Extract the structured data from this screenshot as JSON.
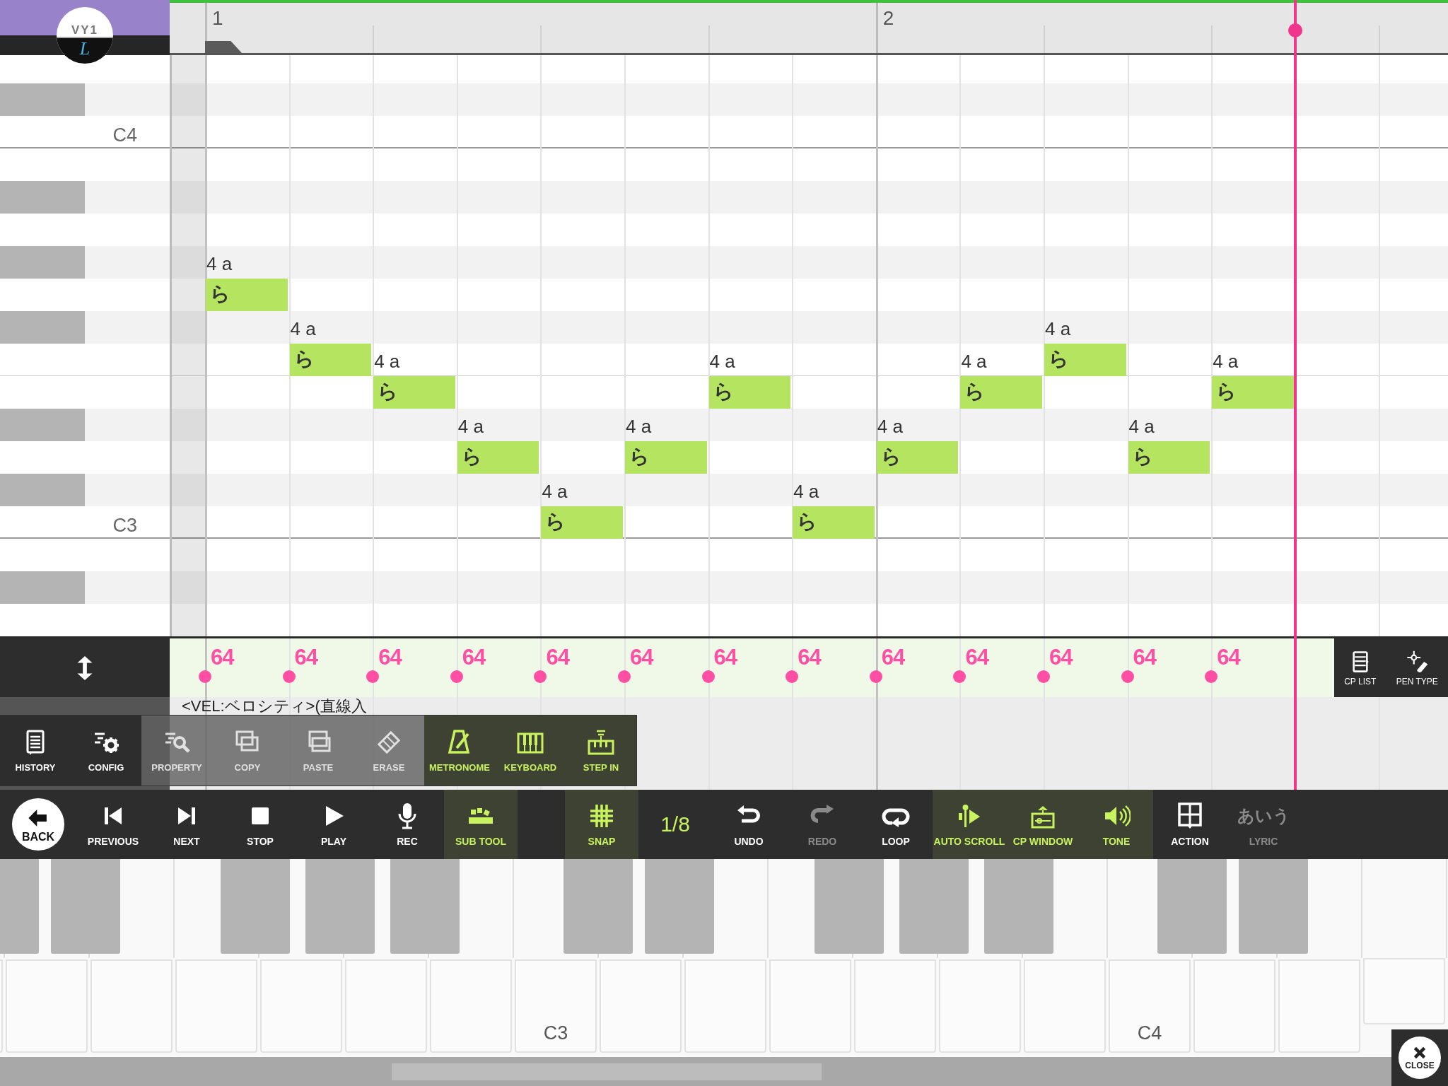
{
  "header": {
    "logo": {
      "title": "VY1",
      "mark": "L"
    },
    "bars": [
      "1",
      "2"
    ]
  },
  "rows": [
    {
      "kind": "white"
    },
    {
      "kind": "black"
    },
    {
      "kind": "white",
      "label": "C4"
    },
    {
      "kind": "white"
    },
    {
      "kind": "black"
    },
    {
      "kind": "white"
    },
    {
      "kind": "black"
    },
    {
      "kind": "white",
      "cells": [
        {
          "kind": "note",
          "label": "4 a",
          "lyric": "ら"
        }
      ]
    },
    {
      "kind": "black"
    },
    {
      "kind": "white",
      "cells": [
        {
          "kind": "rest"
        },
        {
          "kind": "note",
          "label": "4 a",
          "lyric": "ら"
        },
        {
          "kind": "rest"
        },
        {
          "kind": "rest"
        },
        {
          "kind": "rest"
        },
        {
          "kind": "rest"
        },
        {
          "kind": "rest"
        },
        {
          "kind": "rest"
        },
        {
          "kind": "rest"
        },
        {
          "kind": "rest"
        },
        {
          "kind": "note",
          "label": "4 a",
          "lyric": "ら"
        }
      ]
    },
    {
      "kind": "white",
      "cells": [
        {
          "kind": "rest"
        },
        {
          "kind": "rest"
        },
        {
          "kind": "note",
          "label": "4 a",
          "lyric": "ら"
        },
        {
          "kind": "rest"
        },
        {
          "kind": "rest"
        },
        {
          "kind": "rest"
        },
        {
          "kind": "note",
          "label": "4 a",
          "lyric": "ら"
        },
        {
          "kind": "rest"
        },
        {
          "kind": "rest"
        },
        {
          "kind": "note",
          "label": "4 a",
          "lyric": "ら"
        },
        {
          "kind": "rest"
        },
        {
          "kind": "rest"
        },
        {
          "kind": "note",
          "label": "4 a",
          "lyric": "ら"
        }
      ]
    },
    {
      "kind": "black"
    },
    {
      "kind": "white",
      "cells": [
        {
          "kind": "rest"
        },
        {
          "kind": "rest"
        },
        {
          "kind": "rest"
        },
        {
          "kind": "note",
          "label": "4 a",
          "lyric": "ら"
        },
        {
          "kind": "rest"
        },
        {
          "kind": "note",
          "label": "4 a",
          "lyric": "ら"
        },
        {
          "kind": "rest"
        },
        {
          "kind": "rest"
        },
        {
          "kind": "note",
          "label": "4 a",
          "lyric": "ら"
        },
        {
          "kind": "rest"
        },
        {
          "kind": "rest"
        },
        {
          "kind": "note",
          "label": "4 a",
          "lyric": "ら"
        }
      ]
    },
    {
      "kind": "black"
    },
    {
      "kind": "white",
      "label": "C3",
      "cells": [
        {
          "kind": "rest"
        },
        {
          "kind": "rest"
        },
        {
          "kind": "rest"
        },
        {
          "kind": "rest"
        },
        {
          "kind": "note",
          "label": "4 a",
          "lyric": "ら"
        },
        {
          "kind": "rest"
        },
        {
          "kind": "rest"
        },
        {
          "kind": "note",
          "label": "4 a",
          "lyric": "ら"
        }
      ]
    },
    {
      "kind": "white"
    },
    {
      "kind": "black"
    },
    {
      "kind": "white"
    }
  ],
  "velocities": [
    "64",
    "64",
    "64",
    "64",
    "64",
    "64",
    "64",
    "64",
    "64",
    "64",
    "64",
    "64",
    "64"
  ],
  "control_lane": {
    "title": "<VEL:ベロシティ>(直線入"
  },
  "lane_tools": [
    {
      "label": "CP LIST"
    },
    {
      "label": "PEN TYPE"
    }
  ],
  "sub_tools": [
    {
      "label": "HISTORY",
      "on": false,
      "disabled": false
    },
    {
      "label": "CONFIG",
      "on": false,
      "disabled": false
    },
    {
      "label": "PROPERTY",
      "on": false,
      "disabled": true
    },
    {
      "label": "COPY",
      "on": false,
      "disabled": true
    },
    {
      "label": "PASTE",
      "on": false,
      "disabled": true
    },
    {
      "label": "ERASE",
      "on": false,
      "disabled": true
    },
    {
      "label": "METRONOME",
      "on": true,
      "disabled": false
    },
    {
      "label": "KEYBOARD",
      "on": true,
      "disabled": false
    },
    {
      "label": "STEP IN",
      "on": true,
      "disabled": false
    }
  ],
  "toolbar": {
    "back": "BACK",
    "left": [
      {
        "kind": "button",
        "label": "PREVIOUS",
        "on": false,
        "disabled": false
      },
      {
        "kind": "button",
        "label": "NEXT",
        "on": false,
        "disabled": false
      },
      {
        "kind": "button",
        "label": "STOP",
        "on": false,
        "disabled": false
      },
      {
        "kind": "button",
        "label": "PLAY",
        "on": false,
        "disabled": false
      },
      {
        "kind": "button",
        "label": "REC",
        "on": false,
        "disabled": false
      },
      {
        "kind": "button",
        "label": "SUB TOOL",
        "on": true,
        "disabled": false
      }
    ],
    "right": [
      {
        "kind": "button",
        "label": "SNAP",
        "on": true,
        "disabled": false
      },
      {
        "kind": "value",
        "label": "1/8"
      },
      {
        "kind": "button",
        "label": "UNDO",
        "on": false,
        "disabled": false
      },
      {
        "kind": "button",
        "label": "REDO",
        "on": false,
        "disabled": true
      },
      {
        "kind": "button",
        "label": "LOOP",
        "on": false,
        "disabled": false
      },
      {
        "kind": "button",
        "label": "AUTO SCROLL",
        "on": true,
        "disabled": false
      },
      {
        "kind": "button",
        "label": "CP WINDOW",
        "on": true,
        "disabled": false
      },
      {
        "kind": "button",
        "label": "TONE",
        "on": true,
        "disabled": false
      },
      {
        "kind": "button",
        "label": "ACTION",
        "on": false,
        "disabled": false
      },
      {
        "kind": "button",
        "label": "LYRIC",
        "glyph": "あいう",
        "on": false,
        "disabled": true
      }
    ]
  },
  "keyboard": {
    "c_labels": [
      "C3",
      "C4"
    ]
  },
  "close": "CLOSE"
}
